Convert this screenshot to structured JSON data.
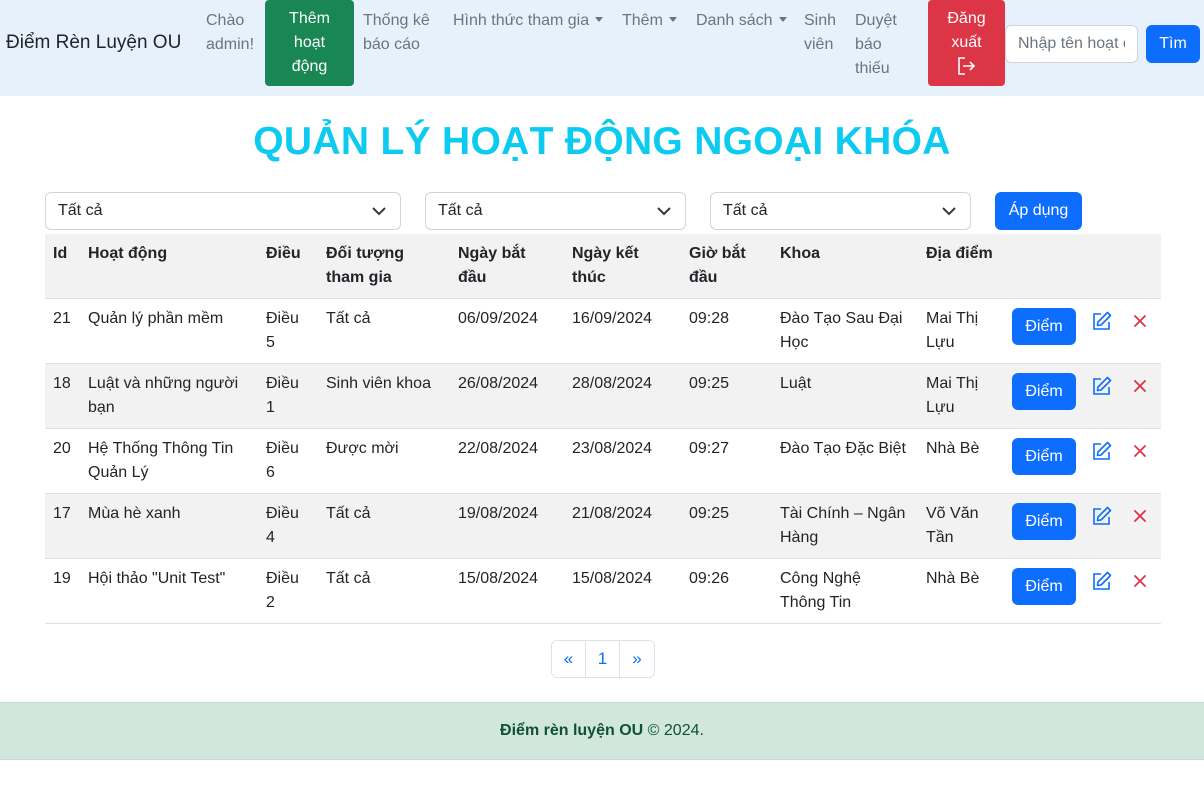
{
  "navbar": {
    "brand": "Điểm Rèn Luyện OU",
    "greeting_line1": "Chào",
    "greeting_line2": "admin!",
    "add_activity": [
      "Thêm",
      "hoạt",
      "động"
    ],
    "report_stats": [
      "Thống kê",
      "báo cáo"
    ],
    "participation_form": "Hình thức tham gia",
    "more": "Thêm",
    "lists": "Danh sách",
    "students": [
      "Sinh",
      "viên"
    ],
    "approve_missing": [
      "Duyệt",
      "báo",
      "thiếu"
    ],
    "logout": [
      "Đăng",
      "xuất"
    ],
    "search_placeholder": "Nhập tên hoạt động",
    "search_button": "Tìm"
  },
  "page_title": "QUẢN LÝ HOẠT ĐỘNG NGOẠI KHÓA",
  "filters": {
    "filter1": "Tất cả",
    "filter2": "Tất cả",
    "filter3": "Tất cả",
    "apply_button": "Áp dụng"
  },
  "table": {
    "headers": {
      "id": "Id",
      "activity": "Hoạt động",
      "rule": "Điều",
      "target": [
        "Đối tượng",
        "tham gia"
      ],
      "start_date": [
        "Ngày bắt",
        "đầu"
      ],
      "end_date": [
        "Ngày kết",
        "thúc"
      ],
      "start_time": [
        "Giờ bắt",
        "đầu"
      ],
      "faculty": "Khoa",
      "location": "Địa điểm"
    },
    "score_button": "Điểm",
    "rows": [
      {
        "id": "21",
        "activity": [
          "Quản lý phần mềm",
          ""
        ],
        "rule": [
          "Điều",
          "5"
        ],
        "target": "Tất cả",
        "start": "06/09/2024",
        "end": "16/09/2024",
        "time": "09:28",
        "faculty": [
          "Đào Tạo Sau Đại",
          "Học"
        ],
        "location": [
          "Mai Thị",
          "Lựu"
        ]
      },
      {
        "id": "18",
        "activity": [
          "Luật và những người",
          "bạn"
        ],
        "rule": [
          "Điều",
          "1"
        ],
        "target": "Sinh viên khoa",
        "start": "26/08/2024",
        "end": "28/08/2024",
        "time": "09:25",
        "faculty": [
          "Luật",
          ""
        ],
        "location": [
          "Mai Thị",
          "Lựu"
        ]
      },
      {
        "id": "20",
        "activity": [
          "Hệ Thống Thông Tin",
          "Quản Lý"
        ],
        "rule": [
          "Điều",
          "6"
        ],
        "target": "Được mời",
        "start": "22/08/2024",
        "end": "23/08/2024",
        "time": "09:27",
        "faculty": [
          "Đào Tạo Đặc Biệt",
          ""
        ],
        "location": [
          "Nhà Bè",
          ""
        ]
      },
      {
        "id": "17",
        "activity": [
          "Mùa hè xanh",
          ""
        ],
        "rule": [
          "Điều",
          "4"
        ],
        "target": "Tất cả",
        "start": "19/08/2024",
        "end": "21/08/2024",
        "time": "09:25",
        "faculty": [
          "Tài Chính – Ngân",
          "Hàng"
        ],
        "location": [
          "Võ Văn",
          "Tần"
        ]
      },
      {
        "id": "19",
        "activity": [
          "Hội thảo \"Unit Test\"",
          ""
        ],
        "rule": [
          "Điều",
          "2"
        ],
        "target": "Tất cả",
        "start": "15/08/2024",
        "end": "15/08/2024",
        "time": "09:26",
        "faculty": [
          "Công Nghệ",
          "Thông Tin"
        ],
        "location": [
          "Nhà Bè",
          ""
        ]
      }
    ]
  },
  "pagination": {
    "prev": "«",
    "page": "1",
    "next": "»"
  },
  "footer": {
    "brand": "Điểm rèn luyện OU",
    "copyright": "© 2024."
  },
  "colors": {
    "primary": "#0d6efd",
    "success": "#198754",
    "danger": "#dc3545",
    "title": "#0dcaf0",
    "navbar_bg": "#e7f1fb",
    "footer_bg": "#d1e7dd"
  },
  "icons": {
    "logout": "logout-icon",
    "edit": "edit-icon",
    "delete": "delete-icon",
    "chevron": "chevron-down-icon"
  }
}
